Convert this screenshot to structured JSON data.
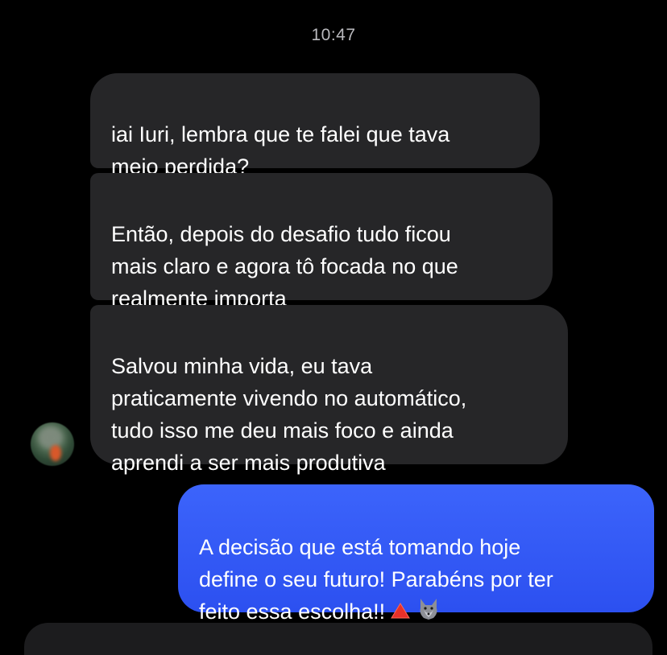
{
  "chat": {
    "timestamp": "10:47",
    "messages": [
      {
        "direction": "incoming",
        "text": "iai Iuri, lembra que te falei que tava\nmeio perdida?"
      },
      {
        "direction": "incoming",
        "text": "Então, depois do desafio tudo ficou\nmais claro e agora tô focada no que\nrealmente importa"
      },
      {
        "direction": "incoming",
        "text": "Salvou minha vida, eu tava\npraticamente vivendo no automático,\ntudo isso me deu mais foco e ainda\naprendi a ser mais produtiva"
      },
      {
        "direction": "outgoing",
        "text": "A decisão que está tomando hoje\ndefine o seu futuro! Parabéns por ter\nfeito essa escolha!!",
        "emojis": [
          "red-triangle-icon",
          "wolf-icon"
        ]
      }
    ]
  },
  "colors": {
    "background": "#000000",
    "incoming_bubble": "#262628",
    "outgoing_bubble": "#2f5cf5",
    "timestamp": "#b9b9bd"
  }
}
